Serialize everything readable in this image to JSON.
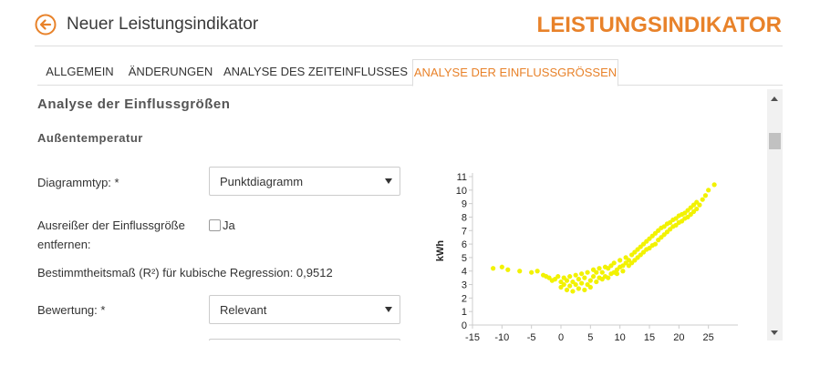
{
  "header": {
    "page_title": "Neuer Leistungsindikator",
    "brand_title": "LEISTUNGSINDIKATOR",
    "accent_color": "#e8822a"
  },
  "tabs": [
    {
      "label": "ALLGEMEIN",
      "active": false
    },
    {
      "label": "ÄNDERUNGEN",
      "active": false
    },
    {
      "label": "ANALYSE DES ZEITEINFLUSSES",
      "active": false
    },
    {
      "label": "ANALYSE DER EINFLUSSGRÖSSEN",
      "active": true
    }
  ],
  "main": {
    "section_title": "Analyse der Einflussgrößen",
    "subsection_title": "Außentemperatur",
    "chart_type_label": "Diagrammtyp: *",
    "chart_type_value": "Punktdiagramm",
    "outlier_label_line1": "Ausreißer der Einflussgröße",
    "outlier_label_line2": "entfernen:",
    "outlier_checkbox_label": "Ja",
    "outlier_checked": false,
    "r2_text": "Bestimmtheitsmaß (R²) für kubische Regression: 0,9512",
    "rating_label": "Bewertung: *",
    "rating_value": "Relevant"
  },
  "chart_data": {
    "type": "scatter",
    "title": "",
    "xlabel": "",
    "ylabel": "kWh",
    "xlim": [
      -15,
      30
    ],
    "ylim": [
      0,
      11
    ],
    "x_ticks": [
      -15,
      -10,
      -5,
      0,
      5,
      10,
      15,
      20,
      25
    ],
    "y_ticks": [
      0,
      1,
      2,
      3,
      4,
      5,
      6,
      7,
      8,
      9,
      10,
      11
    ],
    "grid": false,
    "point_color": "#f2f200",
    "series": [
      {
        "x": [
          -11.5,
          -10,
          -9,
          -7,
          -5,
          -4,
          -3,
          -2.5,
          -2,
          -1.5,
          -1,
          -0.5,
          0,
          0,
          0.5,
          0.5,
          1,
          1,
          1.5,
          1.5,
          2,
          2,
          2.5,
          2.5,
          3,
          3,
          3.5,
          3.5,
          4,
          4,
          4.5,
          4.5,
          5,
          5,
          5.5,
          5.5,
          6,
          6,
          6.5,
          6.5,
          7,
          7,
          7.5,
          7.5,
          8,
          8,
          8.5,
          8.5,
          9,
          9,
          9.5,
          9.5,
          10,
          10,
          10.5,
          10.5,
          11,
          11,
          11.5,
          11.5,
          12,
          12,
          12.5,
          12.5,
          13,
          13,
          13.5,
          13.5,
          14,
          14,
          14.5,
          14.5,
          15,
          15,
          15.5,
          15.5,
          16,
          16,
          16.5,
          16.5,
          17,
          17,
          17.5,
          17.5,
          18,
          18,
          18.5,
          18.5,
          19,
          19,
          19.5,
          19.5,
          20,
          20,
          20.5,
          20.5,
          21,
          21,
          21.5,
          21.5,
          22,
          22,
          22.5,
          22.5,
          23,
          23,
          23.5,
          24,
          24.5,
          25,
          26
        ],
        "y": [
          4.2,
          4.3,
          4.1,
          4.0,
          3.9,
          4.0,
          3.7,
          3.6,
          3.5,
          3.3,
          3.4,
          3.6,
          3.2,
          2.8,
          3.0,
          3.5,
          2.6,
          3.3,
          2.9,
          3.6,
          3.2,
          2.5,
          3.0,
          3.7,
          2.7,
          3.4,
          3.1,
          3.8,
          2.6,
          3.5,
          3.0,
          3.9,
          3.3,
          2.8,
          3.6,
          4.1,
          3.2,
          3.9,
          3.5,
          4.2,
          3.4,
          3.9,
          3.6,
          4.3,
          3.5,
          4.2,
          3.8,
          4.4,
          3.9,
          4.6,
          4.1,
          3.8,
          4.3,
          4.8,
          4.4,
          4.0,
          4.6,
          5.0,
          4.4,
          4.8,
          4.6,
          5.2,
          4.8,
          5.4,
          5.0,
          5.6,
          5.2,
          5.8,
          5.4,
          6.0,
          5.6,
          6.2,
          5.7,
          6.4,
          5.9,
          6.6,
          6.0,
          6.8,
          6.3,
          7.0,
          6.5,
          7.2,
          6.7,
          7.3,
          6.9,
          7.5,
          7.1,
          7.6,
          7.3,
          7.8,
          7.4,
          7.9,
          7.6,
          8.1,
          7.7,
          8.2,
          7.9,
          8.3,
          8.0,
          8.5,
          8.2,
          8.7,
          8.4,
          8.9,
          8.6,
          9.1,
          8.9,
          9.3,
          9.6,
          10.0,
          10.4
        ]
      }
    ]
  }
}
